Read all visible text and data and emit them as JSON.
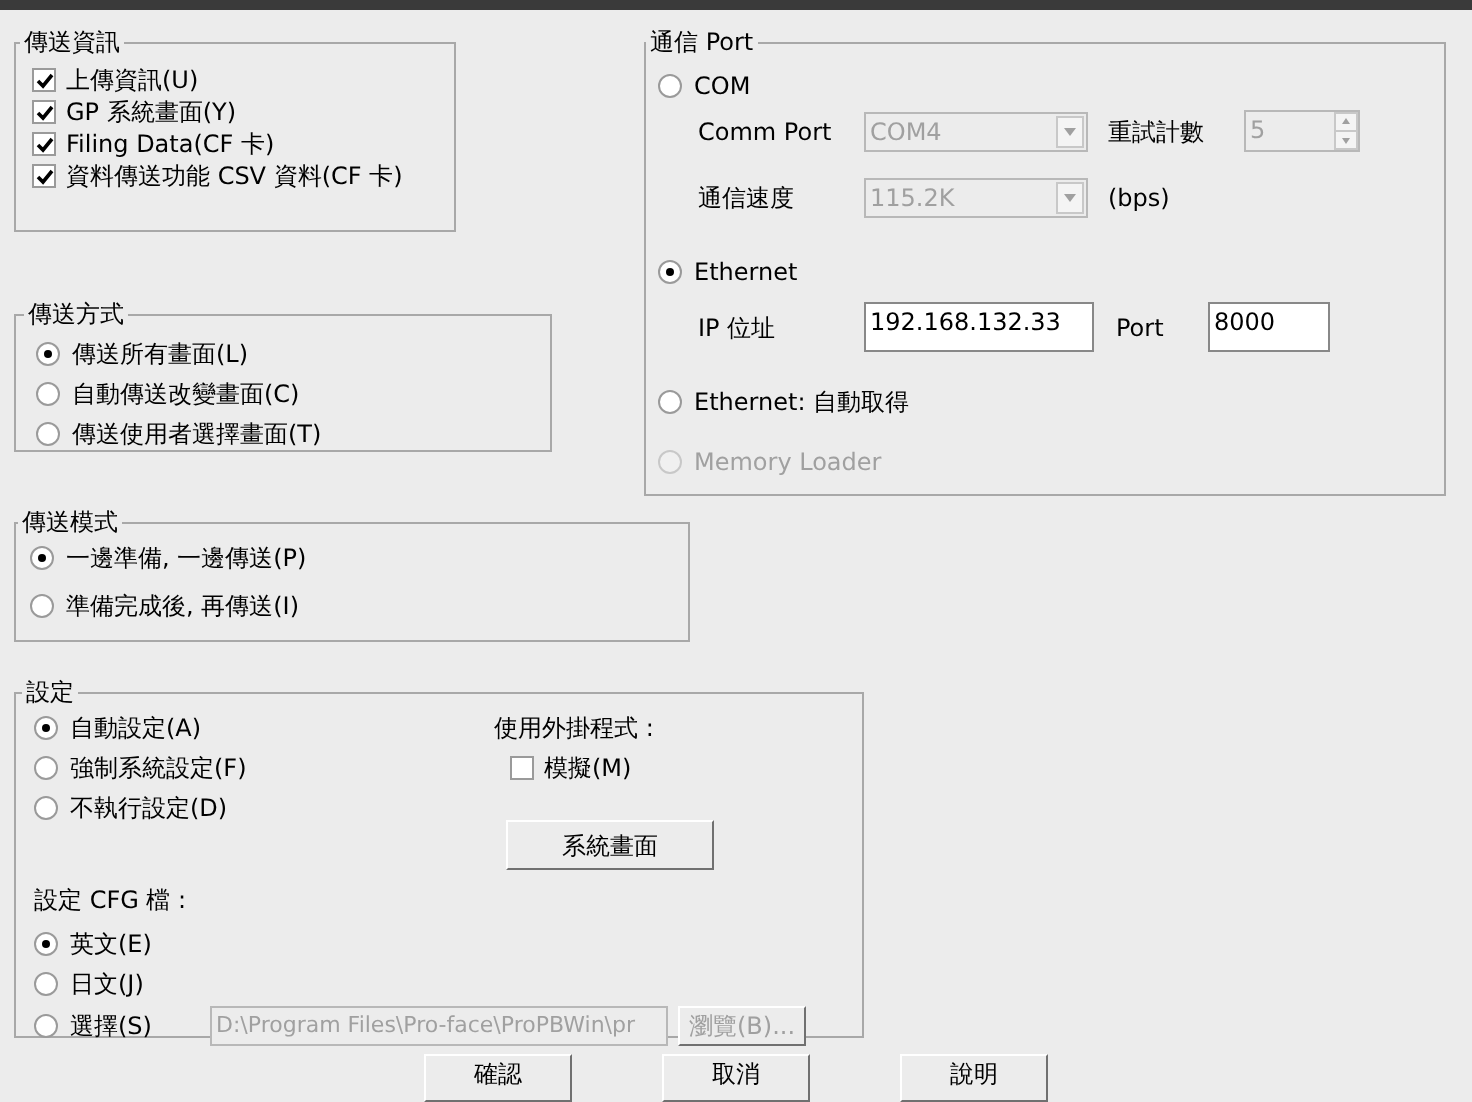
{
  "info_group": {
    "title": "傳送資訊",
    "items": [
      {
        "label": "上傳資訊(U)",
        "checked": true
      },
      {
        "label": "GP 系統畫面(Y)",
        "checked": true
      },
      {
        "label": "Filing Data(CF 卡)",
        "checked": true
      },
      {
        "label": "資料傳送功能 CSV 資料(CF 卡)",
        "checked": true
      }
    ]
  },
  "method_group": {
    "title": "傳送方式",
    "options": [
      {
        "label": "傳送所有畫面(L)",
        "selected": true
      },
      {
        "label": "自動傳送改變畫面(C)",
        "selected": false
      },
      {
        "label": "傳送使用者選擇畫面(T)",
        "selected": false
      }
    ]
  },
  "port_group": {
    "title": "通信 Port",
    "com": {
      "label": "COM",
      "selected": false,
      "disabled": true,
      "comm_port_label": "Comm Port",
      "comm_port_value": "COM4",
      "retry_label": "重試計數",
      "retry_value": "5",
      "speed_label": "通信速度",
      "speed_value": "115.2K",
      "unit": "(bps)"
    },
    "ethernet": {
      "label": "Ethernet",
      "selected": true,
      "ip_label": "IP 位址",
      "ip_value": "192.168.132.33",
      "port_label": "Port",
      "port_value": "8000"
    },
    "ethernet_auto": {
      "label": "Ethernet: 自動取得",
      "selected": false
    },
    "memory_loader": {
      "label": "Memory Loader",
      "selected": false,
      "disabled": true
    }
  },
  "mode_group": {
    "title": "傳送模式",
    "options": [
      {
        "label": "一邊準備, 一邊傳送(P)",
        "selected": true
      },
      {
        "label": "準備完成後, 再傳送(I)",
        "selected": false
      }
    ]
  },
  "settings_group": {
    "title": "設定",
    "options": [
      {
        "label": "自動設定(A)",
        "selected": true
      },
      {
        "label": "強制系統設定(F)",
        "selected": false
      },
      {
        "label": "不執行設定(D)",
        "selected": false
      }
    ],
    "plugin_label": "使用外掛程式 :",
    "simulate": {
      "label": "模擬(M)",
      "checked": false
    },
    "system_button": "系統畫面",
    "cfg_label": "設定 CFG 檔 :",
    "cfg_options": [
      {
        "label": "英文(E)",
        "selected": true
      },
      {
        "label": "日文(J)",
        "selected": false
      },
      {
        "label": "選擇(S)",
        "selected": false
      }
    ],
    "path_value": "D:\\Program Files\\Pro-face\\ProPBWin\\pr",
    "browse_button": "瀏覽(B)...",
    "browse_disabled": true
  },
  "buttons": [
    "確認",
    "取消",
    "說明"
  ]
}
